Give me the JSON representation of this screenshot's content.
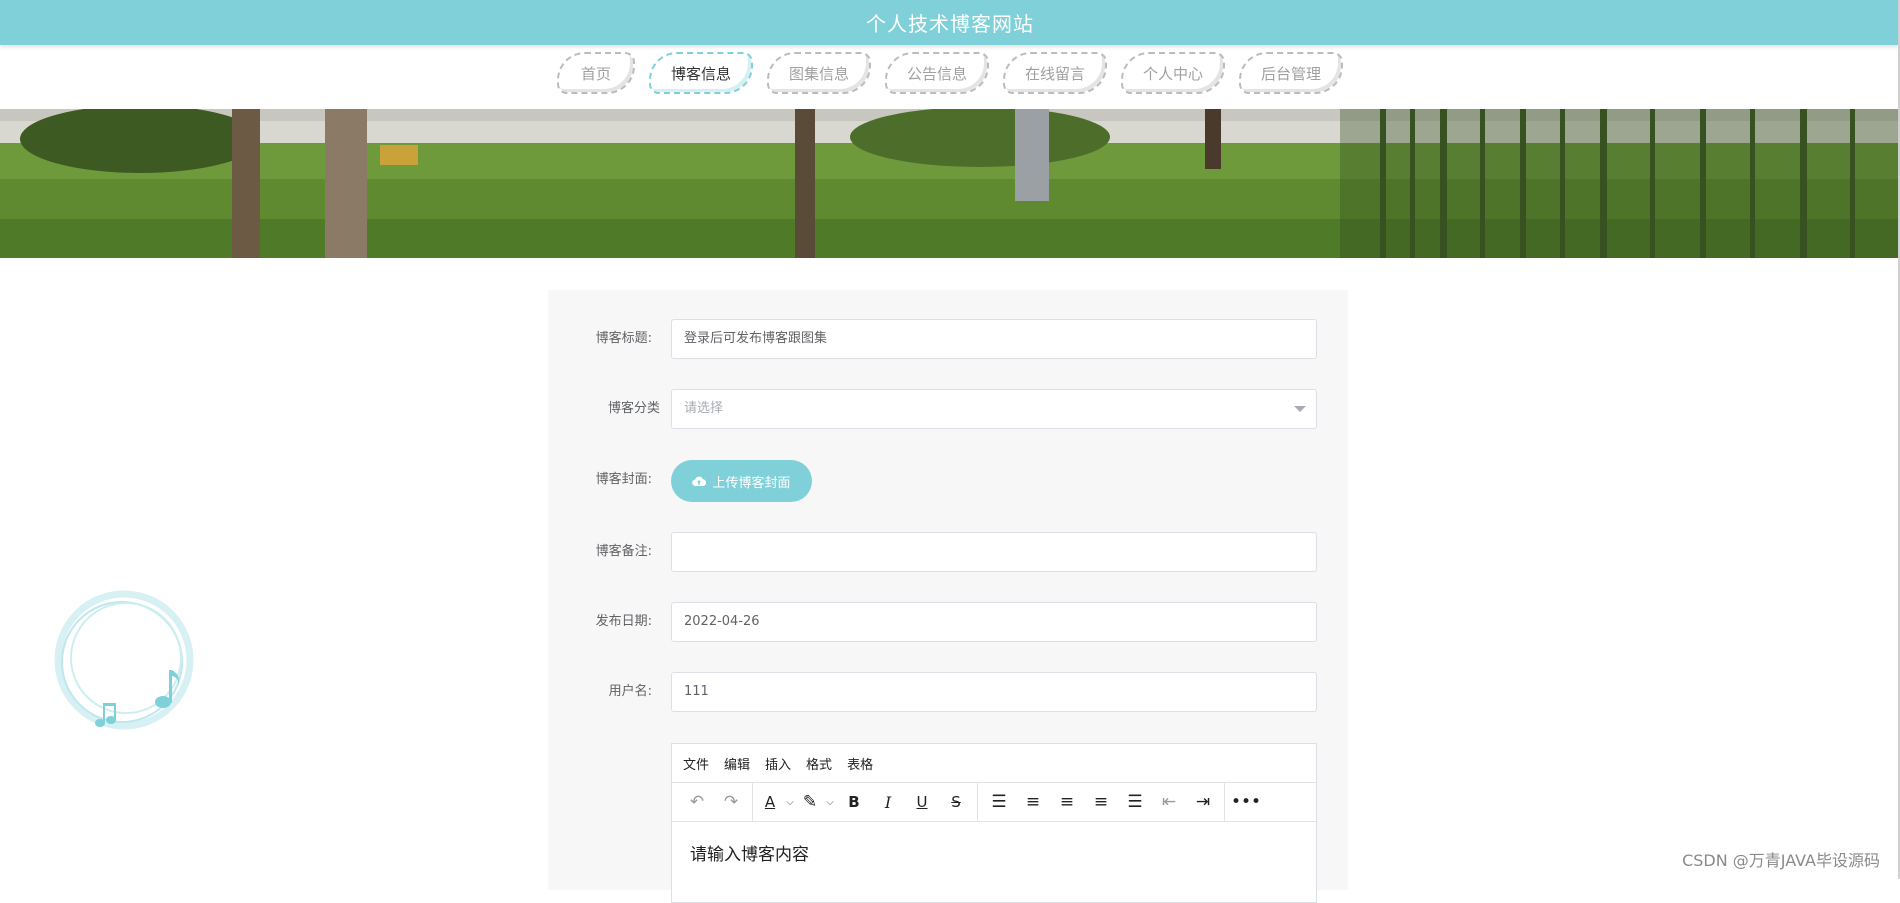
{
  "header": {
    "title": "个人技术博客网站"
  },
  "nav": {
    "items": [
      {
        "label": "首页",
        "active": false
      },
      {
        "label": "博客信息",
        "active": true
      },
      {
        "label": "图集信息",
        "active": false
      },
      {
        "label": "公告信息",
        "active": false
      },
      {
        "label": "在线留言",
        "active": false
      },
      {
        "label": "个人中心",
        "active": false
      },
      {
        "label": "后台管理",
        "active": false
      }
    ]
  },
  "form": {
    "title_label": "博客标题:",
    "title_value": "登录后可发布博客跟图集",
    "category_label": "博客分类",
    "category_placeholder": "请选择",
    "cover_label": "博客封面:",
    "cover_button": "上传博客封面",
    "remark_label": "博客备注:",
    "remark_value": "",
    "date_label": "发布日期:",
    "date_value": "2022-04-26",
    "username_label": "用户名:",
    "username_value": "111"
  },
  "editor": {
    "menus": [
      "文件",
      "编辑",
      "插入",
      "格式",
      "表格"
    ],
    "placeholder": "请输入博客内容"
  },
  "watermark": "CSDN @万青JAVA毕设源码",
  "colors": {
    "accent": "#7fd0d8",
    "card_bg": "#f7f7f7"
  }
}
